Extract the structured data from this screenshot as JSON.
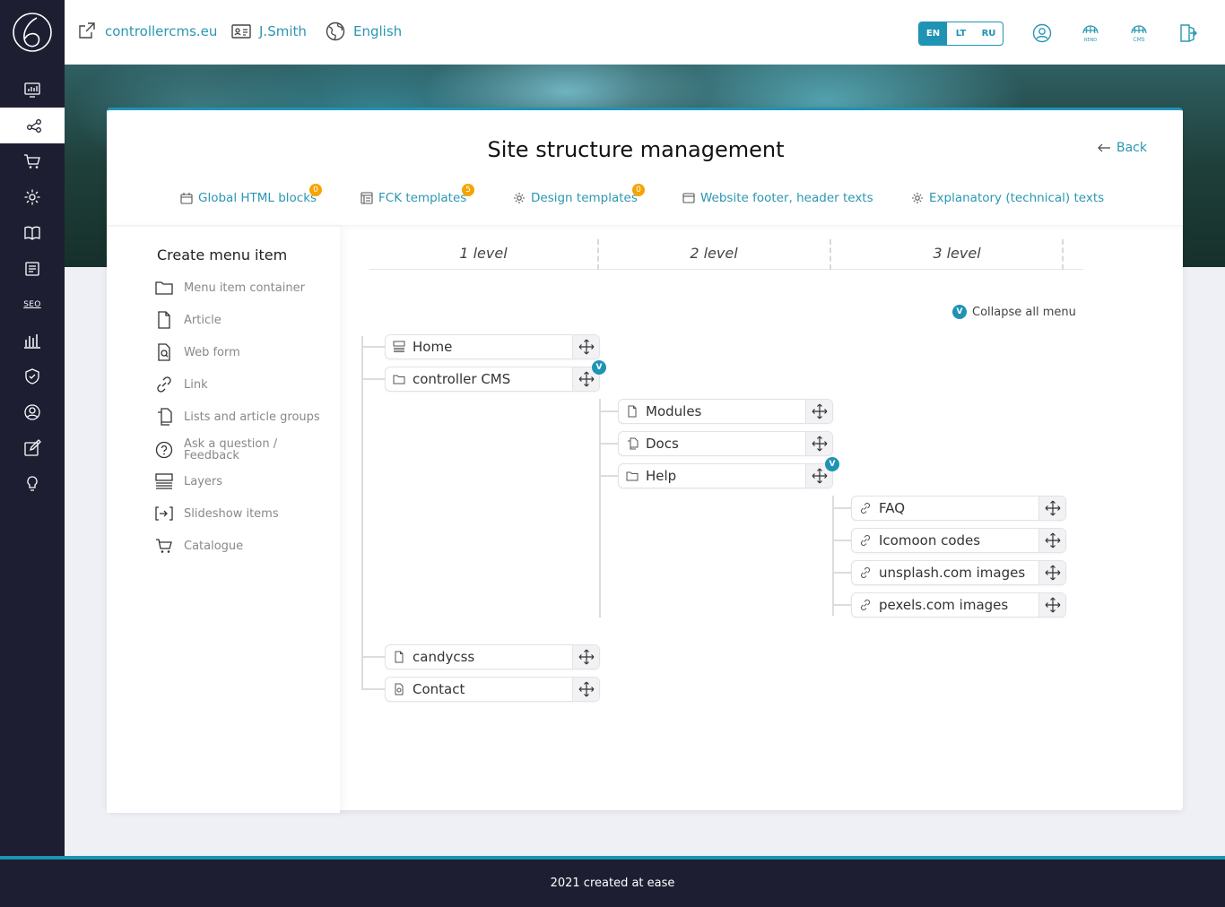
{
  "header": {
    "site_link": "controllercms.eu",
    "user": "J.Smith",
    "language": "English",
    "langs": [
      "EN",
      "LT",
      "RU"
    ],
    "rend_label": "REND",
    "cms_label": "CMS"
  },
  "sidebar": {
    "seo_label": "SEO"
  },
  "page": {
    "title": "Site structure management",
    "back": "Back"
  },
  "tabs": [
    {
      "label": "Global HTML blocks",
      "badge": "0"
    },
    {
      "label": "FCK templates",
      "badge": "5"
    },
    {
      "label": "Design templates",
      "badge": "0"
    },
    {
      "label": "Website footer, header texts"
    },
    {
      "label": "Explanatory (technical) texts"
    }
  ],
  "create": {
    "title": "Create menu item",
    "items": [
      "Menu item container",
      "Article",
      "Web form",
      "Link",
      "Lists and article groups",
      "Ask a question / Feedback",
      "Layers",
      "Slideshow items",
      "Catalogue"
    ]
  },
  "structure": {
    "levels": [
      "1 level",
      "2 level",
      "3 level"
    ],
    "collapse_label": "Collapse all menu",
    "toggle_label": "V",
    "nodes": {
      "home": "Home",
      "controller": "controller CMS",
      "modules": "Modules",
      "docs": "Docs",
      "help": "Help",
      "faq": "FAQ",
      "icomoon": "Icomoon codes",
      "unsplash": "unsplash.com images",
      "pexels": "pexels.com images",
      "candycss": "candycss",
      "contact": "Contact"
    }
  },
  "footer": {
    "text": "2021 created at ease"
  },
  "colors": {
    "accent": "#1f93b3",
    "sidebar": "#1e1e33",
    "badge": "#f5a400"
  }
}
